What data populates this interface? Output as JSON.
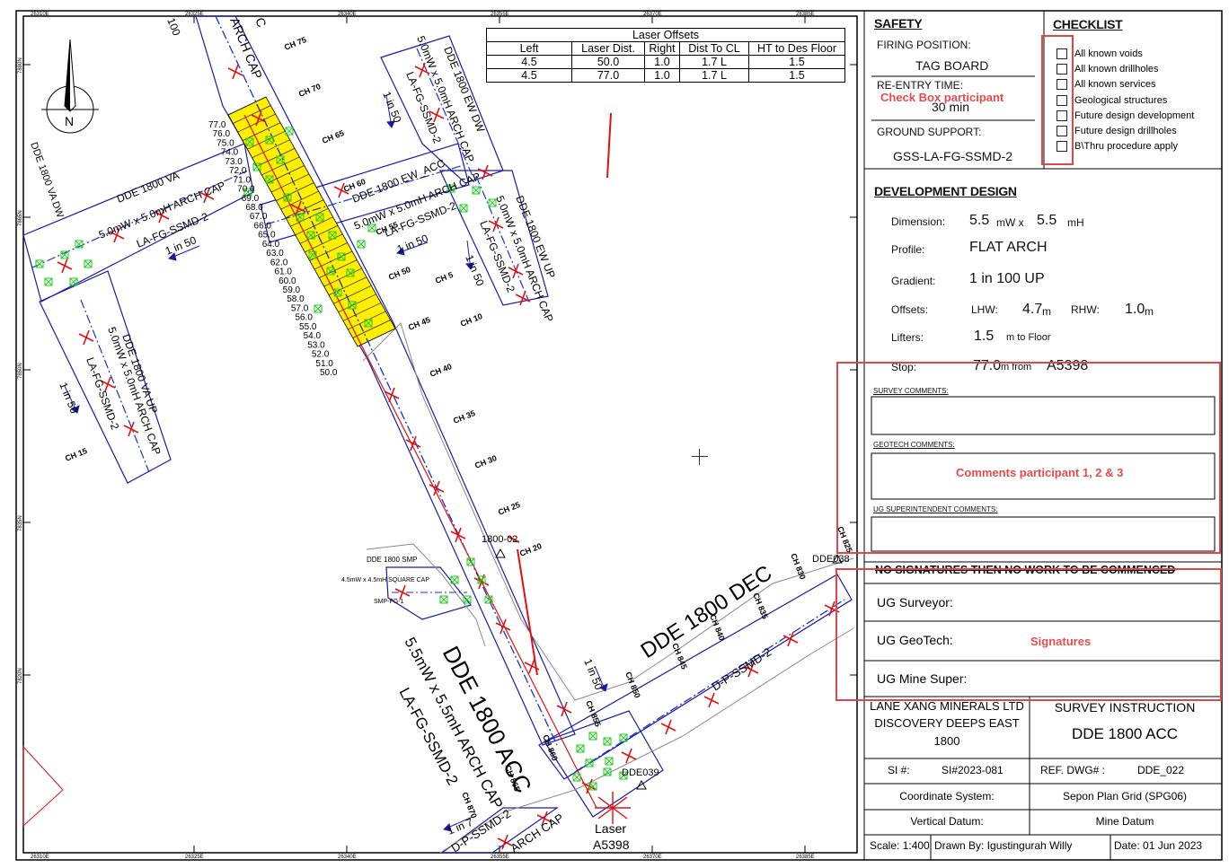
{
  "drawing": {
    "grid_x_labels": [
      "26310E",
      "26325E",
      "26340E",
      "26355E",
      "26370E",
      "26385E"
    ],
    "grid_y_labels": [
      "7880N",
      "7865N",
      "7850N",
      "7835N",
      "7820N"
    ],
    "north_label": "N",
    "labels": {
      "dde_1800_acc": "DDE 1800 ACC",
      "acc_profile": "5.5mW x 5.5mH ARCH CAP",
      "acc_support": "LA-FG-SSMD-2",
      "dde_1800_dec": "DDE 1800 DEC",
      "dec_support": "D-P-SSMD-2",
      "dde_1800_va": "DDE 1800 VA",
      "va_profile": "5.0mW x 5.0mH ARCH CAP",
      "va_support": "LA-FG-SSMD-2",
      "dde_1800_va_up": "DDE 1800 VA UP",
      "va_up_profile": "5.0mW x 5.0mH ARCH CAP",
      "va_up_support": "LA-FG-SSMD-2",
      "dde_1800_va_dw": "DDE 1800 VA DW",
      "dde_1800_ew_acc": "DDE 1800 EW_ACC",
      "ew_profile": "5.0mW x 5.0mH ARCH CAP",
      "ew_support": "LA-FG-SSMD-2",
      "dde_1800_ew_dw": "DDE 1800 EW DW",
      "ew_dw_profile": "5.0mW x 5.0mH ARCH CAP",
      "ew_dw_support": "LA-FG-SSMD-2",
      "dde_1800_ew_up": "DDE 1800 EW UP",
      "ew_up_profile": "5.0mW x 5.0mH ARCH CAP",
      "ew_up_support": "LA-FG-SSMD-2",
      "top_profile": "ARCH CAP",
      "dde_1800_smp": "DDE 1800 SMP",
      "smp_profile": "4.5mW x 4.5mH SQUARE CAP",
      "smp_support": "SMP-FG-1",
      "station_1": "1800-02",
      "station_2": "DDE038",
      "station_3": "DDE039",
      "laser": "Laser",
      "laser_id": "A5398",
      "gradient_1": "1 in 50",
      "gradient_2": "1 in 7",
      "top_c": "C",
      "top_100": "100"
    },
    "chainages": [
      "CH 75",
      "CH 70",
      "CH 65",
      "CH 60",
      "CH 55",
      "CH 50",
      "CH 45",
      "CH 40",
      "CH 35",
      "CH 30",
      "CH 25",
      "CH 20",
      "CH 15",
      "CH 10",
      "CH 5",
      "CH 825",
      "CH 830",
      "CH 835",
      "CH 840",
      "CH 845",
      "CH 850",
      "CH 855",
      "CH 860",
      "CH 865",
      "CH 870"
    ],
    "meter_marks": [
      "77.0",
      "76.0",
      "75.0",
      "74.0",
      "73.0",
      "72.0",
      "71.0",
      "70.0",
      "69.0",
      "68.0",
      "67.0",
      "66.0",
      "65.0",
      "64.0",
      "63.0",
      "62.0",
      "61.0",
      "60.0",
      "59.0",
      "58.0",
      "57.0",
      "56.0",
      "55.0",
      "54.0",
      "53.0",
      "52.0",
      "51.0",
      "50.0"
    ]
  },
  "laser_offsets": {
    "title": "Laser Offsets",
    "headers": [
      "Left",
      "Laser Dist.",
      "Right",
      "Dist To CL",
      "HT to Des Floor"
    ],
    "rows": [
      [
        "4.5",
        "50.0",
        "1.0",
        "1.7 L",
        "1.5"
      ],
      [
        "4.5",
        "77.0",
        "1.0",
        "1.7 L",
        "1.5"
      ]
    ]
  },
  "safety": {
    "title": "SAFETY",
    "firing_position_label": "FIRING POSITION:",
    "firing_position_value": "TAG BOARD",
    "reentry_label": "RE-ENTRY TIME:",
    "reentry_value": "30 min",
    "ground_support_label": "GROUND SUPPORT:",
    "ground_support_value": "GSS-LA-FG-SSMD-2"
  },
  "checklist": {
    "title": "CHECKLIST",
    "items": [
      "All known voids",
      "All known drillholes",
      "All known services",
      "Geological structures",
      "Future design development",
      "Future design drillholes",
      "B\\Thru procedure apply"
    ]
  },
  "design": {
    "title": "DEVELOPMENT DESIGN",
    "dimension_label": "Dimension:",
    "dimension_w": "5.5",
    "dimension_w_unit": "mW x",
    "dimension_h": "5.5",
    "dimension_h_unit": "mH",
    "profile_label": "Profile:",
    "profile_value": "FLAT ARCH",
    "gradient_label": "Gradient:",
    "gradient_value": "1 in 100 UP",
    "offsets_label": "Offsets:",
    "lhw_label": "LHW:",
    "lhw_value": "4.7",
    "rhw_label": "RHW:",
    "rhw_value": "1.0",
    "unit_m": "m",
    "lifters_label": "Lifters:",
    "lifters_value": "1.5",
    "lifters_unit": "m to Floor",
    "stop_label": "Stop:",
    "stop_value": "77.0",
    "stop_mid": "m from",
    "stop_ref": "A5398"
  },
  "comments": {
    "survey": "SURVEY COMMENTS:",
    "geotech": "GEOTECH COMMENTS:",
    "ug_super": "UG SUPERINTENDENT COMMENTS:"
  },
  "signatures": {
    "warning": "NO SIGNATURES THEN NO WORK TO BE COMMENCED",
    "surveyor": "UG Surveyor:",
    "geotech": "UG GeoTech:",
    "mine_super": "UG Mine Super:"
  },
  "title_block": {
    "company_1": "LANE XANG MINERALS LTD",
    "company_2": "DISCOVERY DEEPS EAST",
    "company_3": "1800",
    "doc_type": "SURVEY INSTRUCTION",
    "doc_name": "DDE 1800 ACC",
    "si_label": "SI #:",
    "si_value": "SI#2023-081",
    "ref_label": "REF. DWG# :",
    "ref_value": "DDE_022",
    "coord_label": "Coordinate System:",
    "coord_value": "Sepon Plan Grid (SPG06)",
    "vdatum_label": "Vertical Datum:",
    "vdatum_value": "Mine Datum",
    "scale": "Scale: 1:400",
    "drawn_by": "Drawn By: Igustingurah Willy",
    "date": "Date: 01 Jun 2023"
  },
  "annotations": {
    "checkbox": "Check Box participant",
    "comments": "Comments participant 1, 2 & 3",
    "signatures": "Signatures"
  },
  "colors": {
    "tunnel": "#1a1aa8",
    "design_centerline": "#1a33cc",
    "laser_line": "#e01010",
    "fill_zone": "#ffee00",
    "ground_support_marker": "#22dd22",
    "annotation": "#e84b4b"
  }
}
